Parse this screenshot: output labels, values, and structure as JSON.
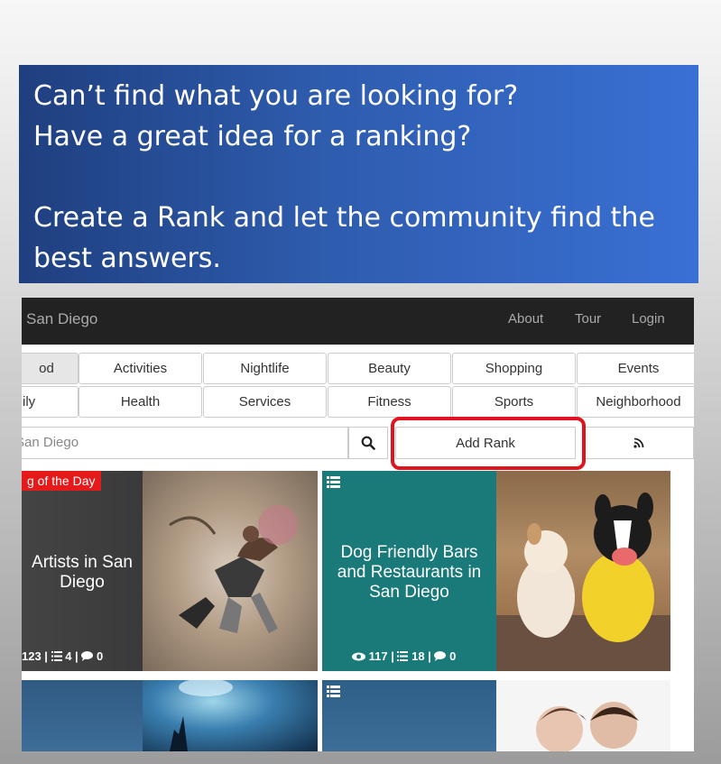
{
  "banner": {
    "line1": "Can’t find what you are looking for?",
    "line2": "Have a great idea for a ranking?",
    "line3": "Create a Rank and let the community find the",
    "line4": "best answers."
  },
  "header": {
    "brand": "San Diego",
    "nav": [
      "About",
      "Tour",
      "Login"
    ]
  },
  "categories": {
    "row1": [
      "od",
      "Activities",
      "Nightlife",
      "Beauty",
      "Shopping",
      "Events"
    ],
    "row2": [
      "ily",
      "Health",
      "Services",
      "Fitness",
      "Sports",
      "Neighborhood"
    ]
  },
  "search": {
    "placeholder": "San Diego",
    "add_rank": "Add Rank"
  },
  "tiles": [
    {
      "ribbon": "g of the Day",
      "title": "Artists in San Diego",
      "stats": "123 |",
      "lists": "4 |",
      "comments": "0"
    },
    {
      "title": "Dog Friendly Bars and Restaurants in San Diego",
      "views": "117 |",
      "lists": "18 |",
      "comments": "0"
    }
  ],
  "colors": {
    "banner_start": "#1f3f7f",
    "banner_end": "#3a70d4",
    "teal_tile": "#1a7a7a",
    "ribbon": "#e51b1b",
    "highlight": "#e0141e"
  }
}
